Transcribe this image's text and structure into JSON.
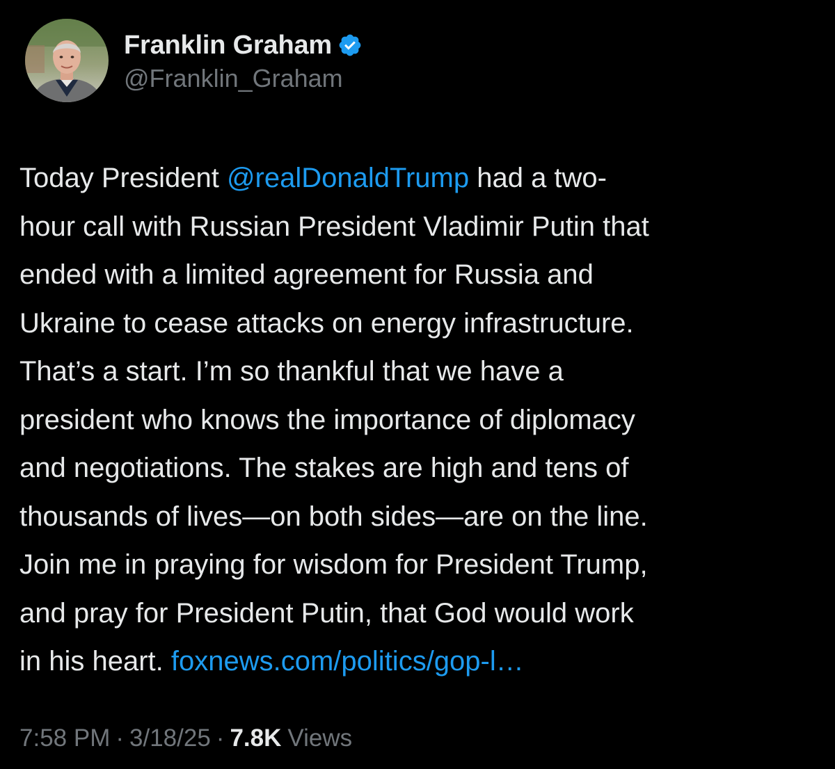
{
  "author": {
    "display_name": "Franklin Graham",
    "handle": "@Franklin_Graham",
    "verified_icon": "verified-badge-icon",
    "avatar_icon": "profile-photo"
  },
  "tweet": {
    "lines": [
      [
        {
          "text": "Today President "
        },
        {
          "text": "@realDonaldTrump",
          "link": true
        },
        {
          "text": " had a two-"
        }
      ],
      [
        {
          "text": "hour call with Russian President Vladimir Putin that"
        }
      ],
      [
        {
          "text": "ended with a limited agreement for Russia and"
        }
      ],
      [
        {
          "text": "Ukraine to cease attacks on energy infrastructure."
        }
      ],
      [
        {
          "text": "That’s a start. I’m so thankful that we have a"
        }
      ],
      [
        {
          "text": "president who knows the importance of diplomacy"
        }
      ],
      [
        {
          "text": "and negotiations. The stakes are high and tens of"
        }
      ],
      [
        {
          "text": "thousands of lives—on both sides—are on the line."
        }
      ],
      [
        {
          "text": "Join me in praying for wisdom for President Trump,"
        }
      ],
      [
        {
          "text": "and pray for President Putin, that God would work"
        }
      ],
      [
        {
          "text": "in his heart. "
        },
        {
          "text": "foxnews.com/politics/gop-l…",
          "link": true
        }
      ]
    ]
  },
  "meta": {
    "time": "7:58 PM",
    "separator": "·",
    "date": "3/18/25",
    "views_count": "7.8K",
    "views_label": "Views"
  },
  "colors": {
    "background": "#000000",
    "text": "#e7e9ea",
    "muted": "#71767b",
    "link": "#1d9bf0"
  }
}
